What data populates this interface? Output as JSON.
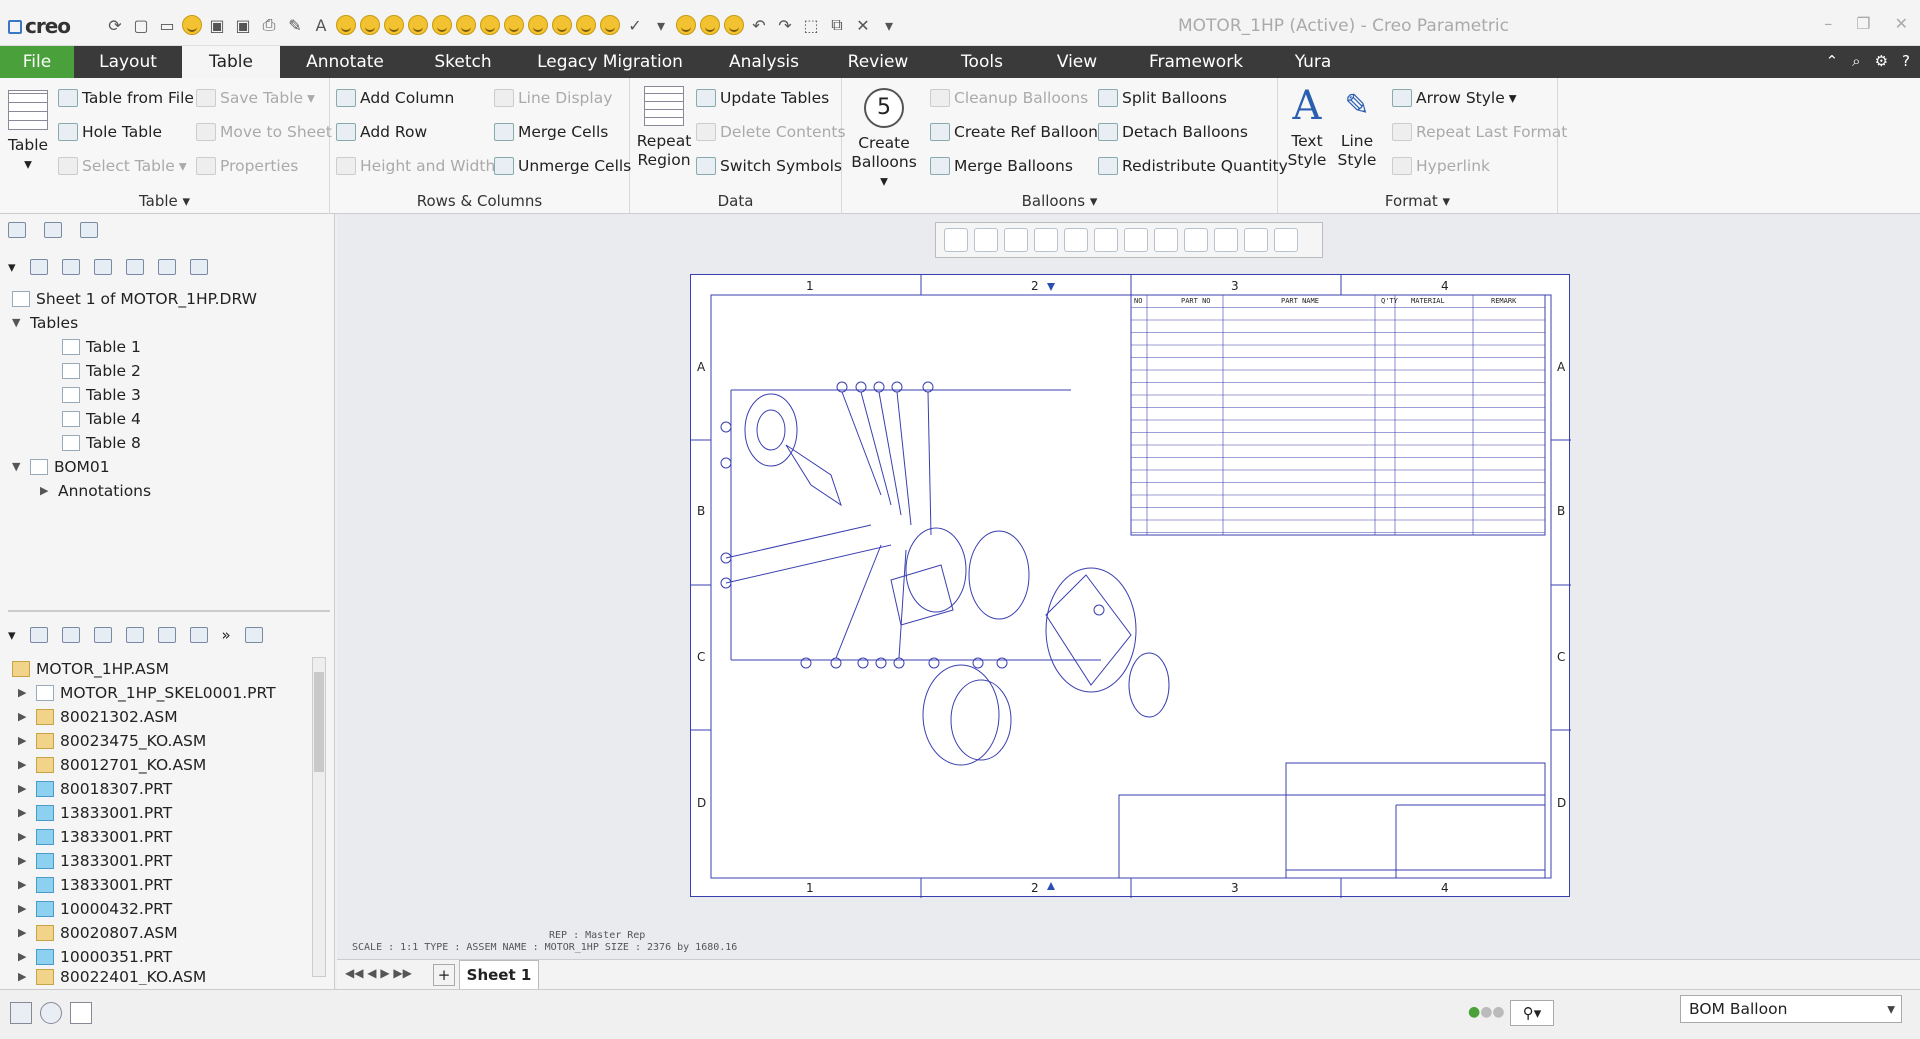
{
  "app": {
    "logo": "creo",
    "window_title": "MOTOR_1HP (Active) - Creo Parametric"
  },
  "tabs": [
    "File",
    "Layout",
    "Table",
    "Annotate",
    "Sketch",
    "Legacy Migration",
    "Analysis",
    "Review",
    "Tools",
    "View",
    "Framework",
    "Yura"
  ],
  "active_tab": "Table",
  "ribbon": {
    "table_group": {
      "label": "Table ▾",
      "big": "Table",
      "items": [
        "Table from File",
        "Hole Table",
        "Select Table",
        "Save Table",
        "Move to Sheet",
        "Properties"
      ]
    },
    "rows_cols": {
      "label": "Rows & Columns",
      "items": [
        "Add Column",
        "Add Row",
        "Height and Width",
        "Line Display",
        "Merge Cells",
        "Unmerge Cells"
      ]
    },
    "data": {
      "label": "Data",
      "big": "Repeat Region",
      "items": [
        "Update Tables",
        "Delete Contents",
        "Switch Symbols"
      ]
    },
    "balloons": {
      "label": "Balloons ▾",
      "big": "Create Balloons",
      "big_glyph": "5",
      "items": [
        "Cleanup Balloons",
        "Create Ref Balloons",
        "Merge Balloons",
        "Split Balloons",
        "Detach Balloons",
        "Redistribute Quantity"
      ]
    },
    "format": {
      "label": "Format ▾",
      "big1": "Text Style",
      "big2": "Line Style",
      "items": [
        "Arrow Style",
        "Repeat Last Format",
        "Hyperlink"
      ]
    }
  },
  "drawing_tree": {
    "root": "Sheet 1 of MOTOR_1HP.DRW",
    "tables_label": "Tables",
    "tables": [
      "Table 1",
      "Table 2",
      "Table 3",
      "Table 4",
      "Table 8"
    ],
    "bom": "BOM01",
    "annotations": "Annotations"
  },
  "model_tree": {
    "root": "MOTOR_1HP.ASM",
    "items": [
      "MOTOR_1HP_SKEL0001.PRT",
      "80021302.ASM",
      "80023475_KO.ASM",
      "80012701_KO.ASM",
      "80018307.PRT",
      "13833001.PRT",
      "13833001.PRT",
      "13833001.PRT",
      "13833001.PRT",
      "10000432.PRT",
      "80020807.ASM",
      "10000351.PRT",
      "80022401_KO.ASM"
    ]
  },
  "sheet_info": {
    "line1": "REP : Master Rep",
    "line2": "SCALE : 1:1     TYPE : ASSEM  NAME : MOTOR_1HP  SIZE : 2376 by 1680.16"
  },
  "sheet_tab": "Sheet 1",
  "status_select": "BOM Balloon",
  "bom_headers": [
    "NO",
    "PART NO",
    "PART NAME",
    "Q'TY",
    "MATERIAL",
    "REMARK"
  ],
  "zones_top": [
    "1",
    "2",
    "3",
    "4"
  ],
  "zones_side": [
    "A",
    "B",
    "C",
    "D"
  ],
  "colors": {
    "accent": "#4aa03a",
    "tabbar": "#3a3a3a",
    "drawing": "#3a3fb0"
  }
}
